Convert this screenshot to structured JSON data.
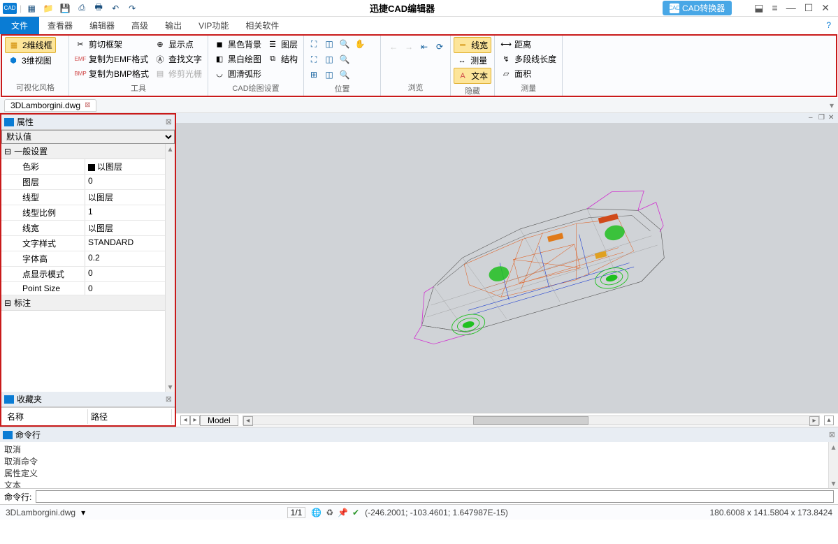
{
  "titlebar": {
    "logo": "CAD",
    "app_title": "迅捷CAD编辑器",
    "convert_btn": "CAD转换器",
    "convert_icon": "CAD"
  },
  "menubar": {
    "file": "文件",
    "items": [
      "查看器",
      "编辑器",
      "高级",
      "输出",
      "VIP功能",
      "相关软件"
    ]
  },
  "ribbon": {
    "grp_visual": {
      "wire2d": "2维线框",
      "view3d": "3维视图",
      "label": "可视化风格"
    },
    "grp_tools": {
      "crop": "剪切框架",
      "copy_emf": "复制为EMF格式",
      "copy_bmp": "复制为BMP格式",
      "show_pt": "显示点",
      "find_text": "查找文字",
      "trim": "修剪光栅",
      "label": "工具"
    },
    "grp_cad": {
      "black_bg": "黑色背景",
      "bw_draw": "黑白绘图",
      "arc": "圆滑弧形",
      "layer": "图层",
      "struct": "结构",
      "label": "CAD绘图设置"
    },
    "grp_pos": {
      "label": "位置"
    },
    "grp_browse": {
      "label": "浏览"
    },
    "grp_hide": {
      "line_w": "线宽",
      "measure": "测量",
      "text": "文本",
      "label": "隐藏"
    },
    "grp_measure": {
      "distance": "距离",
      "polylen": "多段线长度",
      "area": "面积",
      "label": "测量"
    }
  },
  "worktab": {
    "name": "3DLamborgini.dwg"
  },
  "properties": {
    "title": "属性",
    "default": "默认值",
    "section_general": "一般设置",
    "rows": [
      {
        "k": "色彩",
        "v": "以图层",
        "swatch": true
      },
      {
        "k": "图层",
        "v": "0"
      },
      {
        "k": "线型",
        "v": "以图层"
      },
      {
        "k": "线型比例",
        "v": "1"
      },
      {
        "k": "线宽",
        "v": "以图层"
      },
      {
        "k": "文字样式",
        "v": "STANDARD"
      },
      {
        "k": "字体高",
        "v": "0.2"
      },
      {
        "k": "点显示模式",
        "v": "0"
      },
      {
        "k": "Point Size",
        "v": "0"
      }
    ],
    "section_anno": "标注",
    "favorites": "收藏夹",
    "fav_cols": [
      "名称",
      "路径"
    ]
  },
  "viewport": {
    "model_tab": "Model"
  },
  "command": {
    "title": "命令行",
    "history": [
      "取消",
      "取消命令",
      "属性定义",
      "文本"
    ],
    "prompt": "命令行:"
  },
  "statusbar": {
    "file": "3DLamborgini.dwg",
    "page": "1/1",
    "coord": "(-246.2001; -103.4601; 1.647987E-15)",
    "dims": "180.6008 x 141.5804 x 173.8424"
  }
}
